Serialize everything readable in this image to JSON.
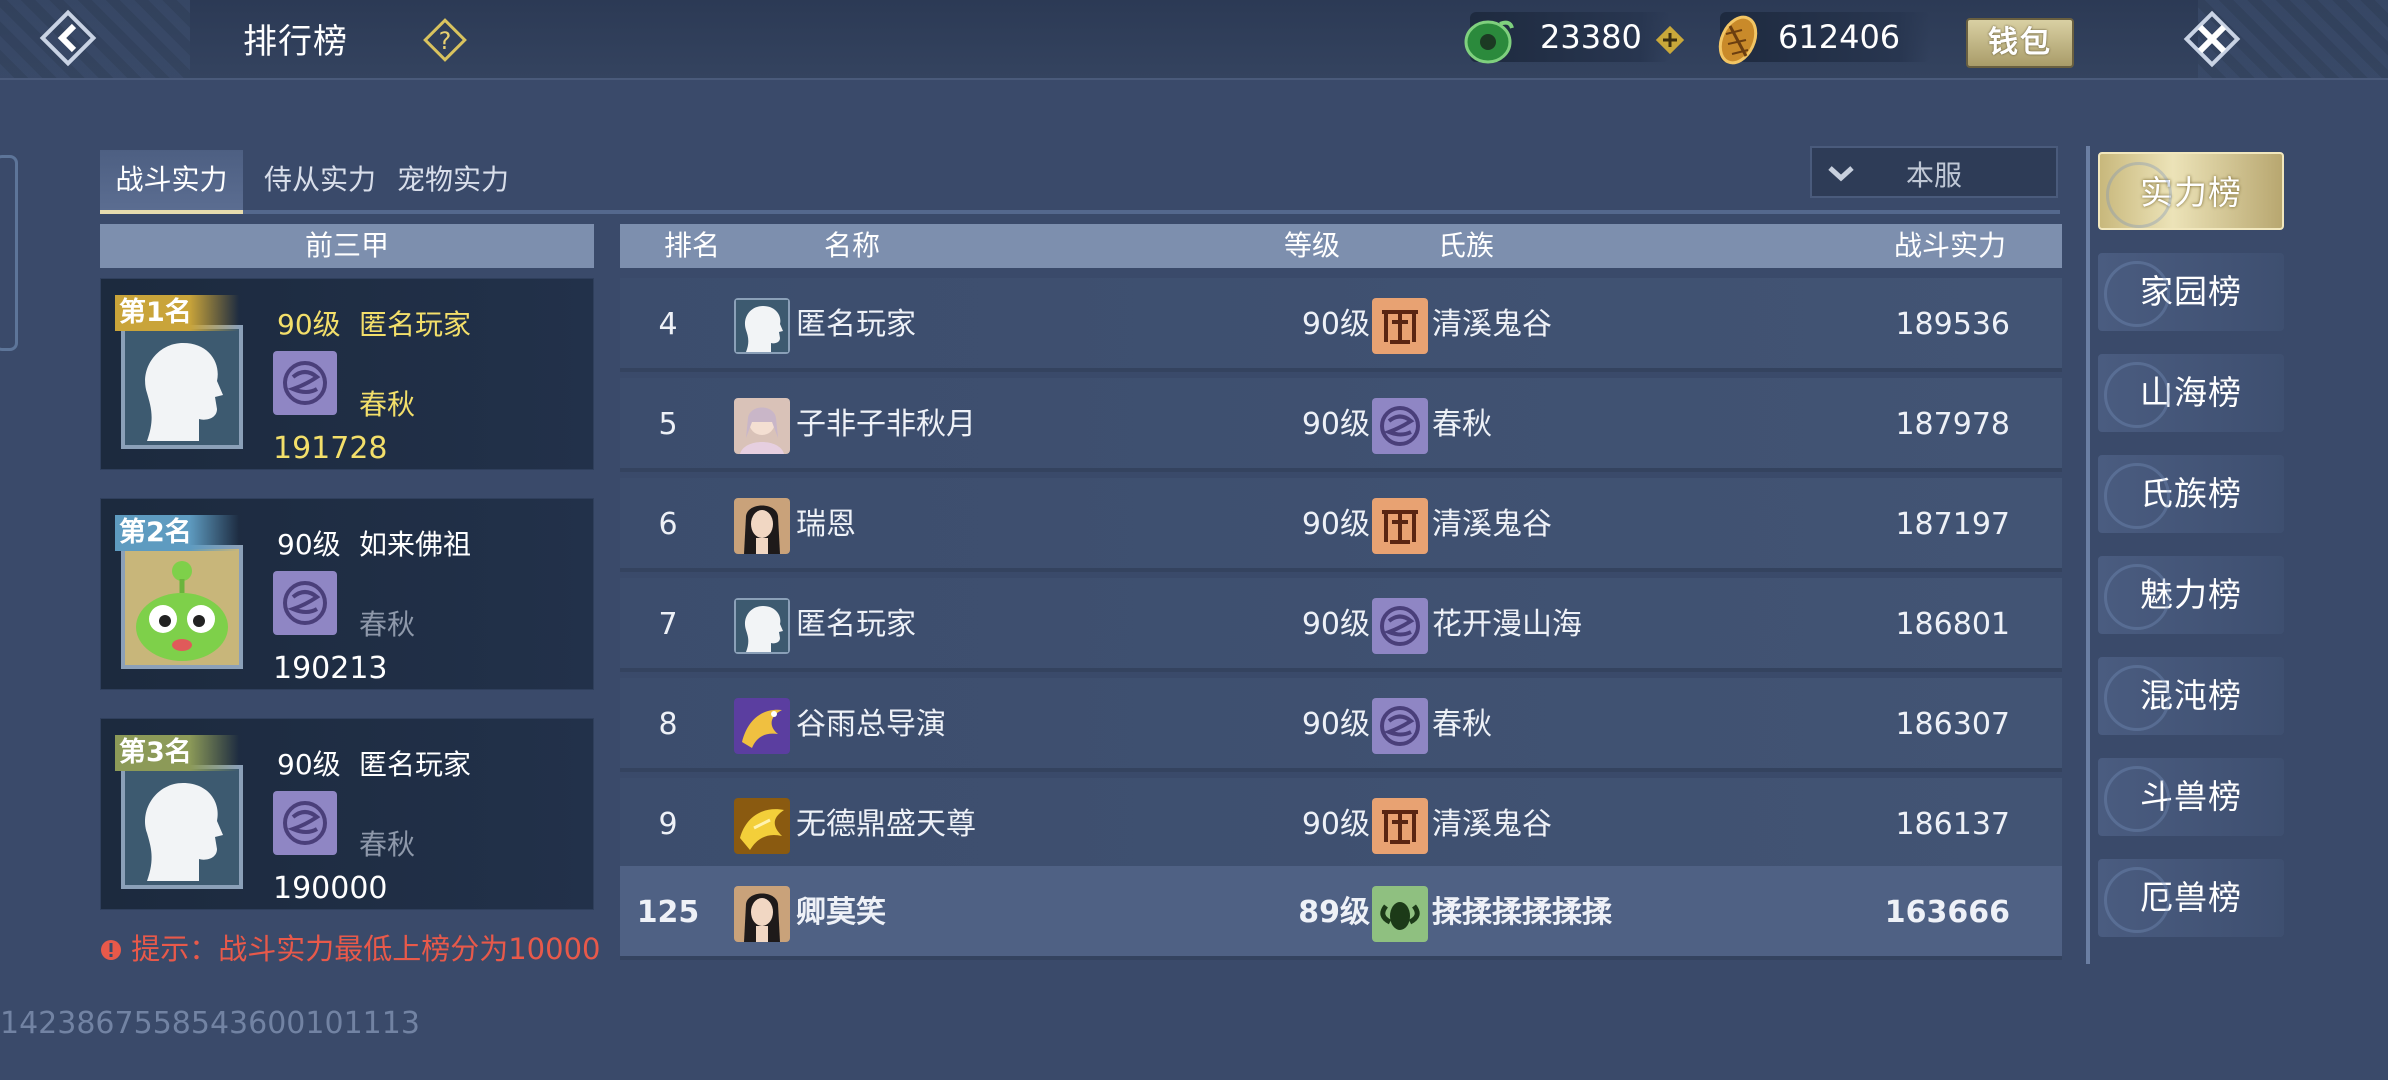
{
  "header": {
    "title": "排行榜",
    "currency_jade": "23380",
    "currency_coin": "612406",
    "wallet_label": "钱包"
  },
  "tabs": [
    {
      "label": "战斗实力",
      "active": true
    },
    {
      "label": "侍从实力",
      "active": false
    },
    {
      "label": "宠物实力",
      "active": false
    }
  ],
  "region_select": {
    "value": "本服"
  },
  "top_three": {
    "header": "前三甲",
    "cards": [
      {
        "rank_label": "第1名",
        "level": "90级",
        "name": "匿名玩家",
        "clan": "春秋",
        "score": "191728"
      },
      {
        "rank_label": "第2名",
        "level": "90级",
        "name": "如来佛祖",
        "clan": "春秋",
        "score": "190213"
      },
      {
        "rank_label": "第3名",
        "level": "90级",
        "name": "匿名玩家",
        "clan": "春秋",
        "score": "190000"
      }
    ]
  },
  "tip": "提示：战斗实力最低上榜分为10000",
  "footer_id": "1423867558543600101113",
  "table": {
    "headers": {
      "rank": "排名",
      "name": "名称",
      "level": "等级",
      "clan": "氏族",
      "power": "战斗实力"
    },
    "rows": [
      {
        "rank": "4",
        "name": "匿名玩家",
        "level": "90级",
        "clan": "清溪鬼谷",
        "power": "189536",
        "avatar": "silhouette",
        "clan_icon": "guigu"
      },
      {
        "rank": "5",
        "name": "子非子非秋月",
        "level": "90级",
        "clan": "春秋",
        "power": "187978",
        "avatar": "portrait-light",
        "clan_icon": "chunqiu"
      },
      {
        "rank": "6",
        "name": "瑞恩",
        "level": "90级",
        "clan": "清溪鬼谷",
        "power": "187197",
        "avatar": "portrait-dark",
        "clan_icon": "guigu"
      },
      {
        "rank": "7",
        "name": "匿名玩家",
        "level": "90级",
        "clan": "花开漫山海",
        "power": "186801",
        "avatar": "silhouette",
        "clan_icon": "chunqiu"
      },
      {
        "rank": "8",
        "name": "谷雨总导演",
        "level": "90级",
        "clan": "春秋",
        "power": "186307",
        "avatar": "dragon-purple",
        "clan_icon": "chunqiu"
      },
      {
        "rank": "9",
        "name": "无德鼎盛天尊",
        "level": "90级",
        "clan": "清溪鬼谷",
        "power": "186137",
        "avatar": "dragon-gold",
        "clan_icon": "guigu"
      }
    ],
    "self_row": {
      "rank": "125",
      "name": "卿莫笑",
      "level": "89级",
      "clan": "揉揉揉揉揉揉",
      "power": "163666",
      "avatar": "portrait-dark",
      "clan_icon": "ram"
    }
  },
  "menu": [
    {
      "label": "实力榜",
      "active": true
    },
    {
      "label": "家园榜",
      "active": false
    },
    {
      "label": "山海榜",
      "active": false
    },
    {
      "label": "氏族榜",
      "active": false
    },
    {
      "label": "魅力榜",
      "active": false
    },
    {
      "label": "混沌榜",
      "active": false
    },
    {
      "label": "斗兽榜",
      "active": false
    },
    {
      "label": "厄兽榜",
      "active": false
    }
  ],
  "colors": {
    "accent_gold": "#f3df6a",
    "tip_red": "#e8594a",
    "background": "#3a4a6a"
  }
}
